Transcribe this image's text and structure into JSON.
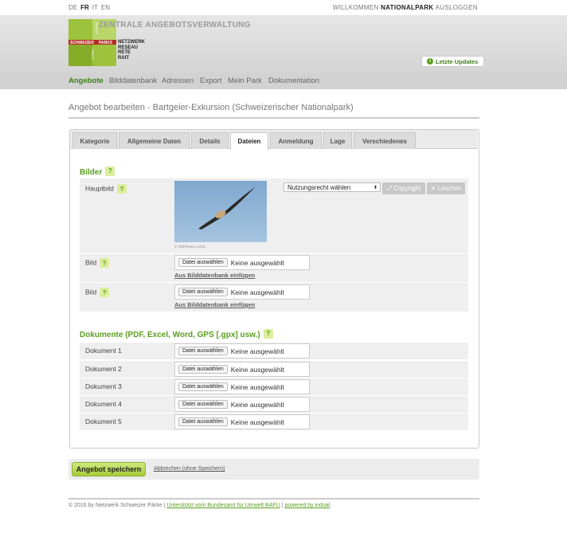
{
  "top": {
    "languages": [
      "DE",
      "FR",
      "IT",
      "EN"
    ],
    "welcome": "WILLKOMMEN",
    "user": "NATIONALPARK",
    "logout": "AUSLOGGEN"
  },
  "header": {
    "title": "ZENTRALE ANGEBOTSVERWALTUNG",
    "logo_text": {
      "parchi": "PARCHI",
      "schweizer": "SCHWEIZER",
      "parks": "PARKS",
      "parcs": "PARCS"
    },
    "network_lines": [
      "NETZWERK",
      "RESEAU",
      "RETE",
      "RAIT"
    ],
    "updates_button": "Letzte Updates"
  },
  "nav": {
    "items": [
      "Angebote",
      "Bilddatenbank",
      "Adressen",
      "Export",
      "Mein Park",
      "Dokumentation"
    ]
  },
  "page_title": "Angebot bearbeiten - Bartgeier-Exkursion (Schweizerischer Nationalpark)",
  "tabs": [
    "Kategorie",
    "Allgemeine Daten",
    "Details",
    "Dateien",
    "Anmeldung",
    "Lage",
    "Verschiedenes"
  ],
  "bilder": {
    "title": "Bilder",
    "help": "?",
    "main_label": "Hauptbild",
    "caption": "© SNP/Hans Lozza",
    "rights_select": "Nutzungsrecht wählen",
    "copyright_button": "Copyright",
    "delete_button": "Löschen",
    "image_label": "Bild",
    "file_button": "Datei auswählen",
    "no_file": "Keine ausgewählt",
    "db_link": "Aus Bilddatenbank einfügen"
  },
  "documents": {
    "title": "Dokumente (PDF, Excel, Word, GPS [.gpx] usw.)",
    "labels": [
      "Dokument 1",
      "Dokument 2",
      "Dokument 3",
      "Dokument 4",
      "Dokument 5"
    ]
  },
  "actions": {
    "save": "Angebot speichern",
    "cancel": "Abbrechen (ohne Speichern)"
  },
  "footer": {
    "copyright": "© 2016 by Netzwerk Schweizer Pärke |",
    "bafu": "Unterstützt vom Bundesamt für Umwelt BAFU",
    "sep": "|",
    "indual": "powered by indual"
  },
  "colors": {
    "accent": "#5a9e1e",
    "header_bg": "#dcdcdc",
    "row_bg": "#efefef"
  }
}
